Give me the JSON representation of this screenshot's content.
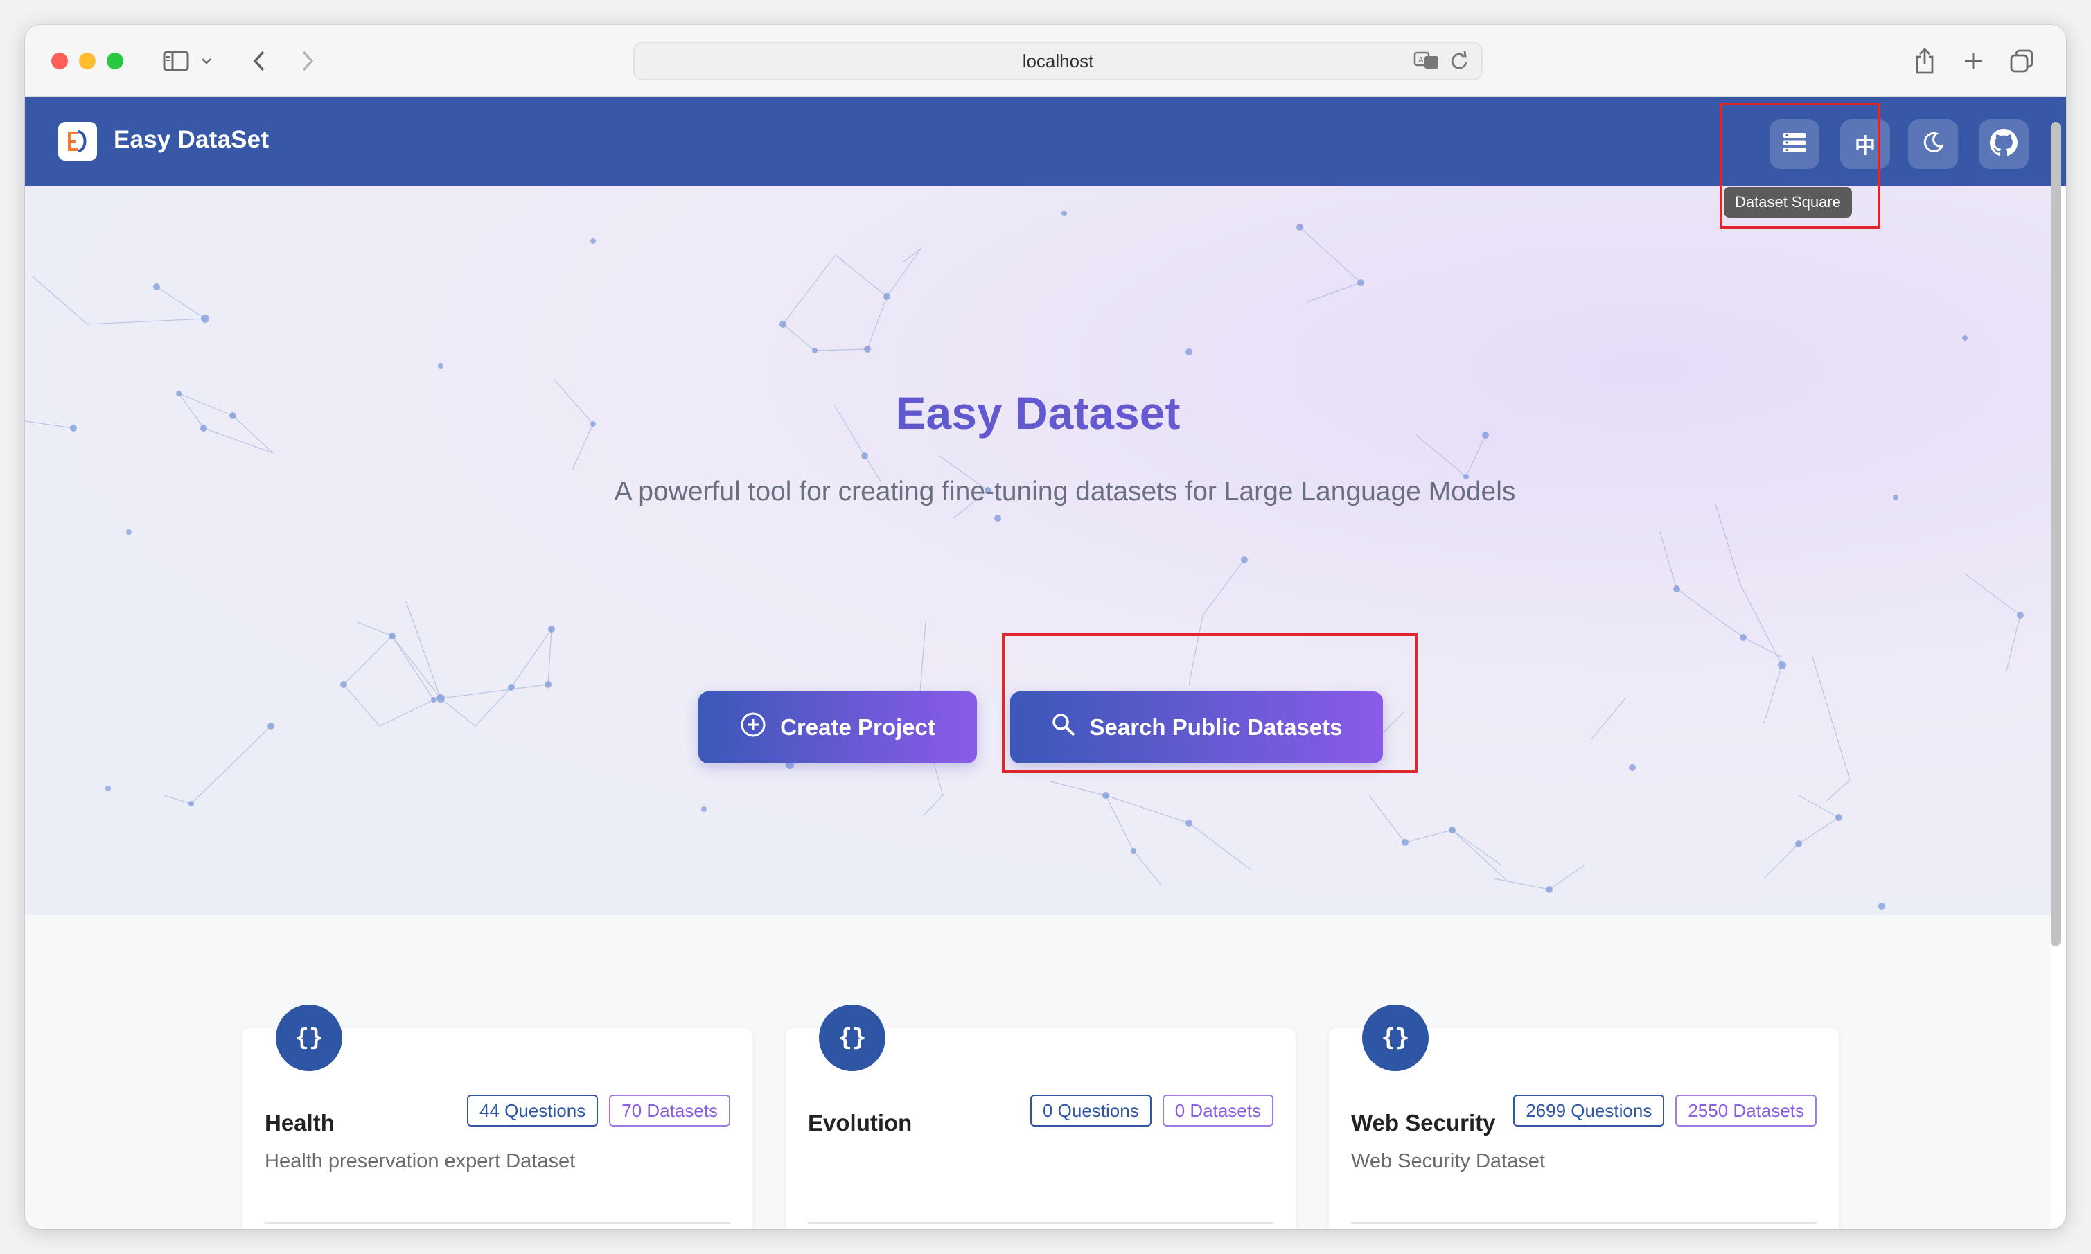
{
  "browser": {
    "url": "localhost"
  },
  "header": {
    "app_title": "Easy DataSet",
    "tooltip": "Dataset Square",
    "lang_label": "中"
  },
  "hero": {
    "title": "Easy Dataset",
    "subtitle": "A powerful tool for creating fine-tuning datasets for Large Language Models",
    "create_label": "Create Project",
    "search_label": "Search Public Datasets"
  },
  "cards": [
    {
      "name": "Health",
      "questions": "44 Questions",
      "datasets": "70 Datasets",
      "description": "Health preservation expert Dataset"
    },
    {
      "name": "Evolution",
      "questions": "0 Questions",
      "datasets": "0 Datasets",
      "description": ""
    },
    {
      "name": "Web Security",
      "questions": "2699 Questions",
      "datasets": "2550 Datasets",
      "description": "Web Security Dataset"
    }
  ],
  "colors": {
    "header_bg": "#3658a7",
    "accent_start": "#3b58b8",
    "accent_end": "#8a5be8",
    "highlight": "#e0262a"
  }
}
